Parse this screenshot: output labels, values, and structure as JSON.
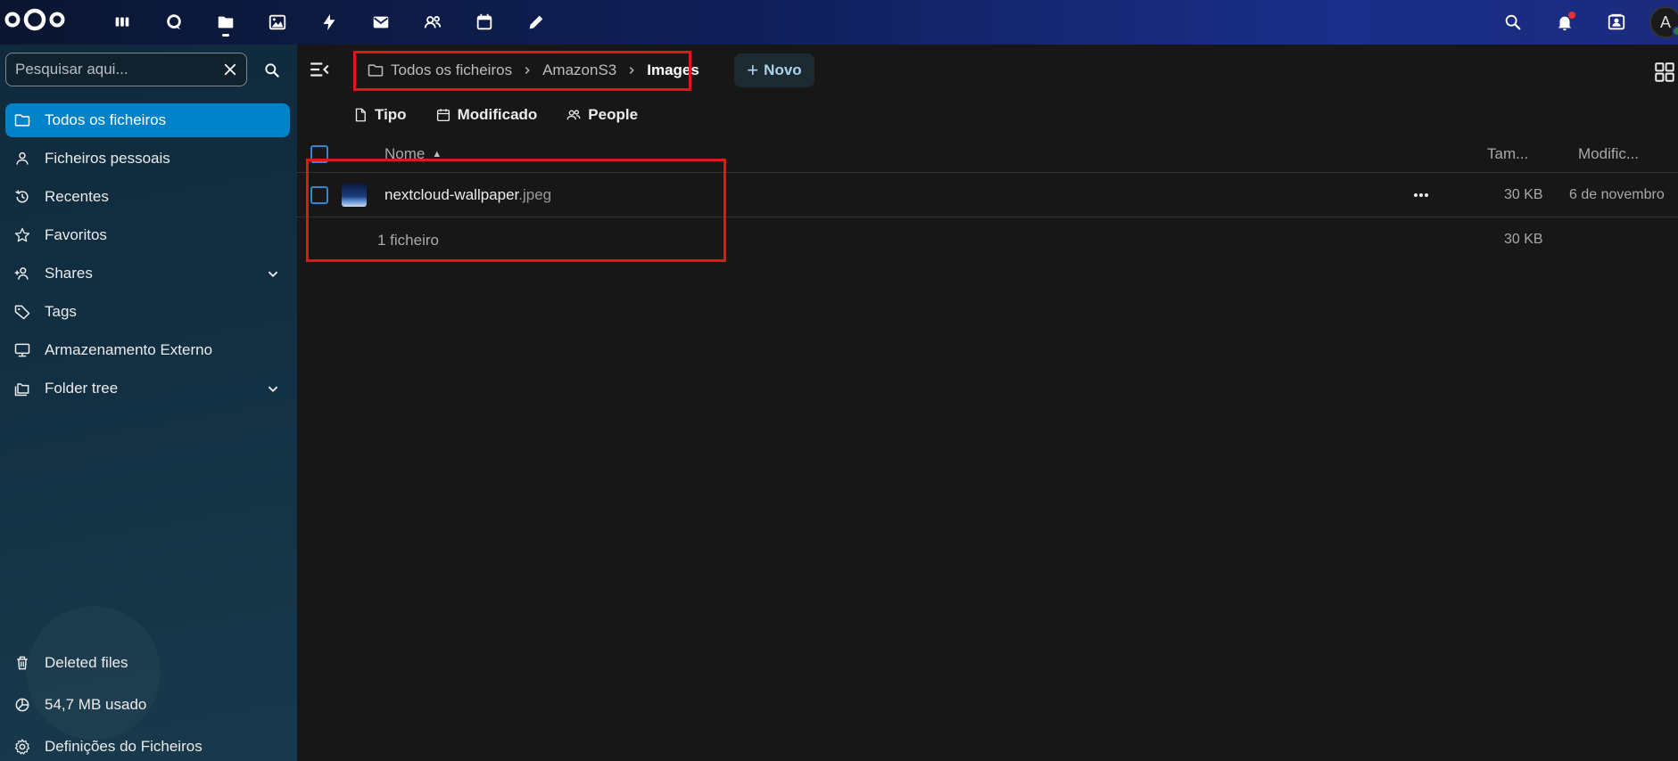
{
  "topbar": {
    "apps": [
      {
        "name": "dashboard",
        "icon": "dashboard-icon"
      },
      {
        "name": "talk",
        "icon": "talk-icon"
      },
      {
        "name": "files",
        "icon": "folder-icon",
        "active": true
      },
      {
        "name": "photos",
        "icon": "image-icon"
      },
      {
        "name": "activity",
        "icon": "lightning-icon"
      },
      {
        "name": "mail",
        "icon": "mail-icon"
      },
      {
        "name": "contacts",
        "icon": "contacts-icon"
      },
      {
        "name": "calendar",
        "icon": "calendar-icon"
      },
      {
        "name": "notes",
        "icon": "pencil-icon"
      }
    ],
    "avatar_initial": "A"
  },
  "sidebar": {
    "search_placeholder": "Pesquisar aqui...",
    "items": [
      {
        "label": "Todos os ficheiros",
        "icon": "folder-icon",
        "active": true
      },
      {
        "label": "Ficheiros pessoais",
        "icon": "account-icon"
      },
      {
        "label": "Recentes",
        "icon": "history-icon"
      },
      {
        "label": "Favoritos",
        "icon": "star-icon"
      },
      {
        "label": "Shares",
        "icon": "share-icon",
        "expandable": true
      },
      {
        "label": "Tags",
        "icon": "tag-icon"
      },
      {
        "label": "Armazenamento Externo",
        "icon": "monitor-icon"
      },
      {
        "label": "Folder tree",
        "icon": "folder-multiple-icon",
        "expandable": true
      }
    ],
    "bottom": [
      {
        "label": "Deleted files",
        "icon": "trash-icon"
      },
      {
        "label": "54,7 MB usado",
        "icon": "chart-pie-icon"
      },
      {
        "label": "Definições do Ficheiros",
        "icon": "gear-icon"
      }
    ]
  },
  "main": {
    "breadcrumb": [
      "Todos os ficheiros",
      "AmazonS3",
      "Images"
    ],
    "new_button": "Novo",
    "filters": [
      {
        "label": "Tipo",
        "icon": "file-icon"
      },
      {
        "label": "Modificado",
        "icon": "calendar-icon"
      },
      {
        "label": "People",
        "icon": "people-icon"
      }
    ],
    "columns": {
      "name": "Nome",
      "size": "Tam...",
      "modified": "Modific..."
    },
    "files": [
      {
        "basename": "nextcloud-wallpaper",
        "extension": ".jpeg",
        "size": "30 KB",
        "modified": "6 de novembro"
      }
    ],
    "summary": {
      "count": "1 ficheiro",
      "total": "30 KB"
    }
  },
  "colors": {
    "accent": "#0082c9",
    "highlight_box": "#e0161c",
    "checkbox": "#2f85d6"
  }
}
